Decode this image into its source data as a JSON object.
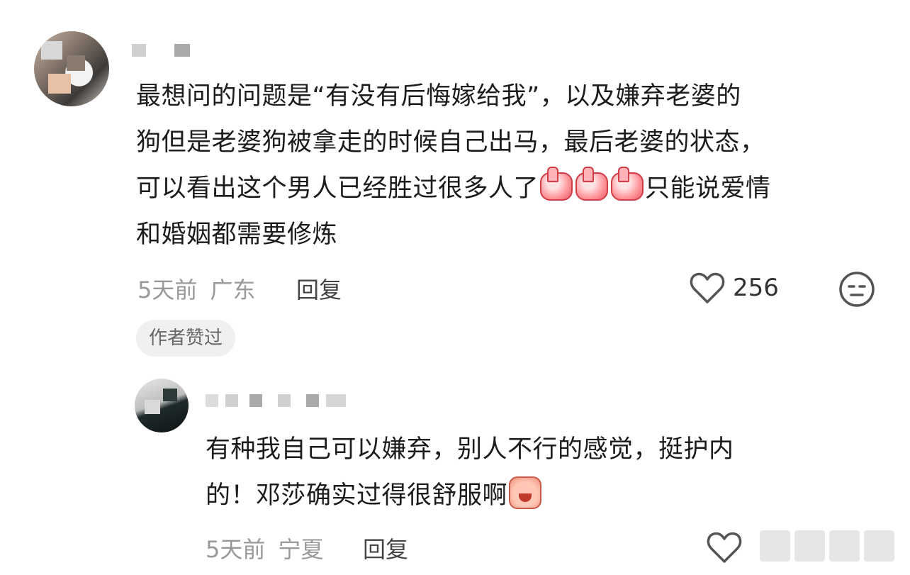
{
  "comments": [
    {
      "text_part1": "最想问的问题是“有没有后悔嫁给我”，以及嫌弃老婆的",
      "text_part2": "狗但是老婆狗被拿走的时候自己出马，最后老婆的状态，",
      "text_part3": "可以看出这个男人已经胜过很多人了",
      "text_part4": "只能说爱情",
      "text_part5": "和婚姻都需要修炼",
      "time": "5天前",
      "location": "广东",
      "reply_label": "回复",
      "likes": "256",
      "badge": "作者赞过",
      "icons": [
        "heart-outline-icon",
        "emoji-face-icon",
        "thumbs-up-emoji"
      ]
    },
    {
      "text_part1": "有种我自己可以嫌弃，别人不行的感觉，挺护内",
      "text_part2": "的！邓莎确实过得很舒服啊",
      "time": "5天前",
      "location": "宁夏",
      "reply_label": "回复",
      "icons": [
        "heart-outline-icon",
        "crying-face-emoji"
      ]
    }
  ]
}
